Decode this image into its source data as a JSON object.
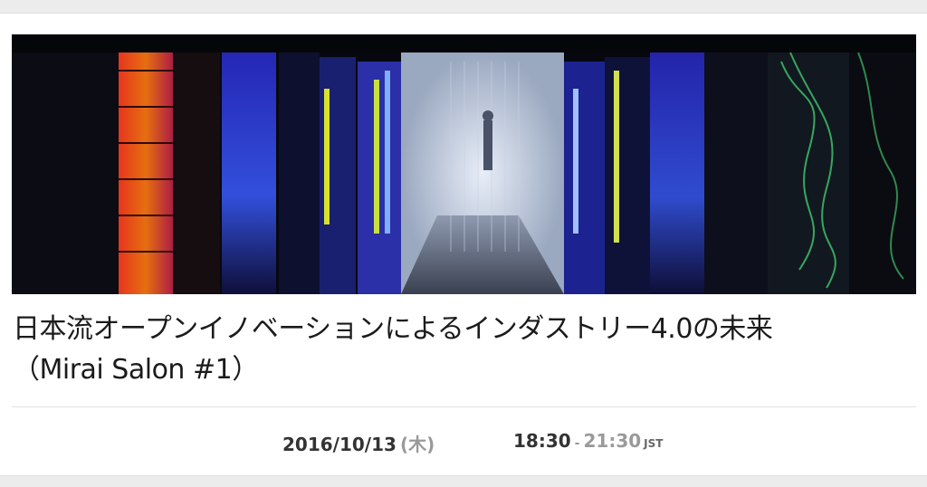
{
  "colors": {
    "page_background": "#ececec",
    "card_background": "#ffffff",
    "title_text": "#1b1b1b",
    "meta_text": "#333333",
    "muted_text": "#9a9a9a"
  },
  "hero": {
    "image_subject": "server-room-aisle-photo"
  },
  "event": {
    "title_line1": "日本流オープンイノベーションによるインダストリー4.0の未来",
    "title_line2": "（Mirai Salon #1）",
    "date": "2016/10/13",
    "weekday": "(木)",
    "time_start": "18:30",
    "time_separator": "-",
    "time_end": "21:30",
    "timezone": "JST"
  }
}
